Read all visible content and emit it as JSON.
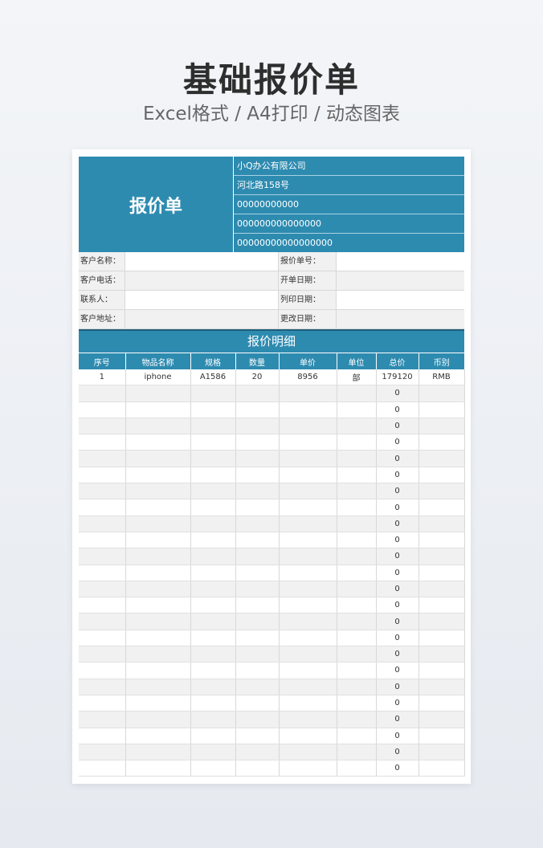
{
  "page": {
    "title": "基础报价单",
    "subtitle": "Excel格式 / A4打印 / 动态图表"
  },
  "header": {
    "doc_title": "报价单",
    "company_lines": [
      "小Q办公有限公司",
      "河北路158号",
      "00000000000",
      "000000000000000",
      "00000000000000000"
    ]
  },
  "info": {
    "rows": [
      {
        "label": "客户名称：",
        "label2": "报价单号："
      },
      {
        "label": "客户电话：",
        "label2": "开单日期："
      },
      {
        "label": "联系人：",
        "label2": "列印日期："
      },
      {
        "label": "客户地址：",
        "label2": "更改日期："
      }
    ]
  },
  "detail": {
    "title": "报价明细",
    "columns": [
      "序号",
      "物品名称",
      "规格",
      "数量",
      "单价",
      "单位",
      "总价",
      "币别"
    ],
    "rows": [
      [
        "1",
        "iphone",
        "A1586",
        "20",
        "8956",
        "部",
        "179120",
        "RMB"
      ],
      [
        "",
        "",
        "",
        "",
        "",
        "",
        "0",
        ""
      ],
      [
        "",
        "",
        "",
        "",
        "",
        "",
        "0",
        ""
      ],
      [
        "",
        "",
        "",
        "",
        "",
        "",
        "0",
        ""
      ],
      [
        "",
        "",
        "",
        "",
        "",
        "",
        "0",
        ""
      ],
      [
        "",
        "",
        "",
        "",
        "",
        "",
        "0",
        ""
      ],
      [
        "",
        "",
        "",
        "",
        "",
        "",
        "0",
        ""
      ],
      [
        "",
        "",
        "",
        "",
        "",
        "",
        "0",
        ""
      ],
      [
        "",
        "",
        "",
        "",
        "",
        "",
        "0",
        ""
      ],
      [
        "",
        "",
        "",
        "",
        "",
        "",
        "0",
        ""
      ],
      [
        "",
        "",
        "",
        "",
        "",
        "",
        "0",
        ""
      ],
      [
        "",
        "",
        "",
        "",
        "",
        "",
        "0",
        ""
      ],
      [
        "",
        "",
        "",
        "",
        "",
        "",
        "0",
        ""
      ],
      [
        "",
        "",
        "",
        "",
        "",
        "",
        "0",
        ""
      ],
      [
        "",
        "",
        "",
        "",
        "",
        "",
        "0",
        ""
      ],
      [
        "",
        "",
        "",
        "",
        "",
        "",
        "0",
        ""
      ],
      [
        "",
        "",
        "",
        "",
        "",
        "",
        "0",
        ""
      ],
      [
        "",
        "",
        "",
        "",
        "",
        "",
        "0",
        ""
      ],
      [
        "",
        "",
        "",
        "",
        "",
        "",
        "0",
        ""
      ],
      [
        "",
        "",
        "",
        "",
        "",
        "",
        "0",
        ""
      ],
      [
        "",
        "",
        "",
        "",
        "",
        "",
        "0",
        ""
      ],
      [
        "",
        "",
        "",
        "",
        "",
        "",
        "0",
        ""
      ],
      [
        "",
        "",
        "",
        "",
        "",
        "",
        "0",
        ""
      ],
      [
        "",
        "",
        "",
        "",
        "",
        "",
        "0",
        ""
      ],
      [
        "",
        "",
        "",
        "",
        "",
        "",
        "0",
        ""
      ]
    ]
  },
  "colors": {
    "accent": "#2e8bb0",
    "dark_rule": "#1f5f7a"
  }
}
